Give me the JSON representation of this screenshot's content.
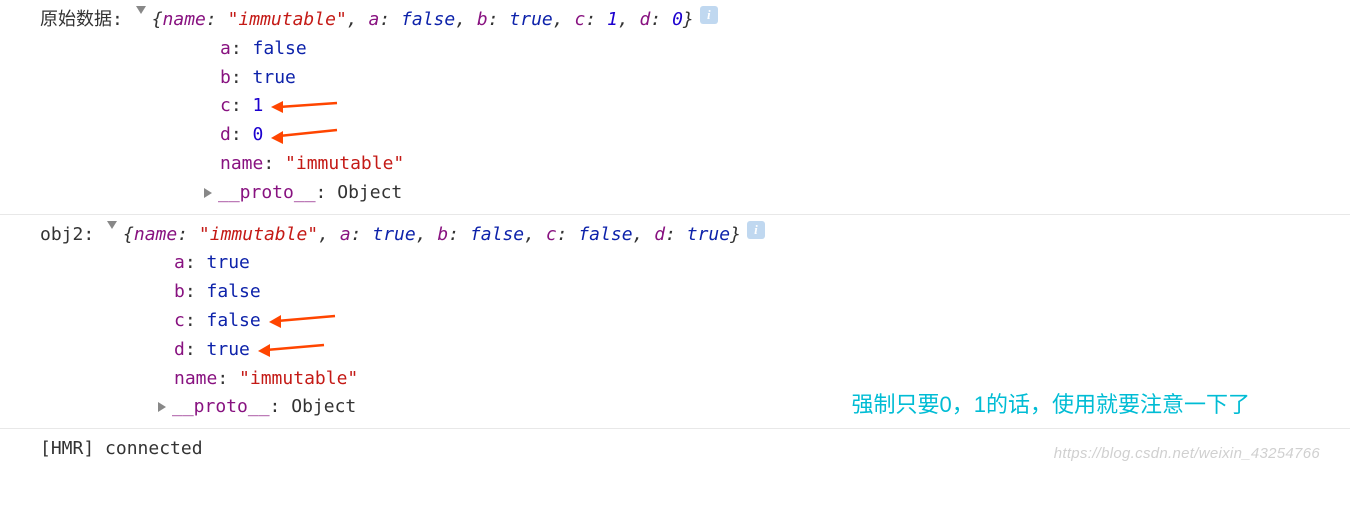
{
  "blocks": [
    {
      "label": "原始数据:",
      "summary": {
        "name_key": "name",
        "name_val": "\"immutable\"",
        "pairs": [
          {
            "k": "a",
            "v": "false",
            "type": "bool"
          },
          {
            "k": "b",
            "v": "true",
            "type": "bool"
          },
          {
            "k": "c",
            "v": "1",
            "type": "num"
          },
          {
            "k": "d",
            "v": "0",
            "type": "num"
          }
        ]
      },
      "props": [
        {
          "key": "a",
          "val": "false",
          "type": "bool",
          "arrow": false
        },
        {
          "key": "b",
          "val": "true",
          "type": "bool",
          "arrow": false
        },
        {
          "key": "c",
          "val": "1",
          "type": "num",
          "arrow": true
        },
        {
          "key": "d",
          "val": "0",
          "type": "num",
          "arrow": true
        },
        {
          "key": "name",
          "val": "\"immutable\"",
          "type": "str",
          "arrow": false
        }
      ],
      "proto": {
        "key": "__proto__",
        "val": "Object"
      }
    },
    {
      "label": "obj2:",
      "summary": {
        "name_key": "name",
        "name_val": "\"immutable\"",
        "pairs": [
          {
            "k": "a",
            "v": "true",
            "type": "bool"
          },
          {
            "k": "b",
            "v": "false",
            "type": "bool"
          },
          {
            "k": "c",
            "v": "false",
            "type": "bool"
          },
          {
            "k": "d",
            "v": "true",
            "type": "bool"
          }
        ]
      },
      "props": [
        {
          "key": "a",
          "val": "true",
          "type": "bool",
          "arrow": false
        },
        {
          "key": "b",
          "val": "false",
          "type": "bool",
          "arrow": false
        },
        {
          "key": "c",
          "val": "false",
          "type": "bool",
          "arrow": true
        },
        {
          "key": "d",
          "val": "true",
          "type": "bool",
          "arrow": true
        },
        {
          "key": "name",
          "val": "\"immutable\"",
          "type": "str",
          "arrow": false
        }
      ],
      "proto": {
        "key": "__proto__",
        "val": "Object"
      }
    }
  ],
  "footer": "[HMR] connected",
  "annotation": "强制只要0，1的话，使用就要注意一下了",
  "watermark": "https://blog.csdn.net/weixin_43254766"
}
